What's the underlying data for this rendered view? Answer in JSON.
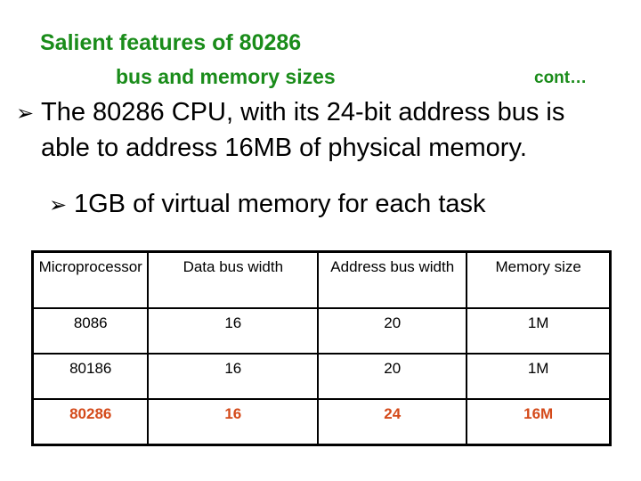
{
  "slide": {
    "title": "Salient features of 80286",
    "subtitle": "bus and memory sizes",
    "continuation": "cont…",
    "bullets": [
      {
        "icon": "arrowhead-bullet-icon",
        "glyph": "➢",
        "line1": "The 80286 CPU, with its 24-bit address bus is",
        "line2": "able to address 16MB of physical memory."
      },
      {
        "icon": "arrowhead-bullet-icon",
        "glyph": "➢",
        "text": "1GB of virtual memory for each task"
      }
    ],
    "colors": {
      "heading": "#1a8c1a",
      "highlight": "#d44a1a",
      "text": "#000000"
    }
  },
  "table": {
    "headers": [
      "Microprocessor",
      "Data bus width",
      "Address bus width",
      "Memory size"
    ],
    "rows": [
      [
        "8086",
        "16",
        "20",
        "1M"
      ],
      [
        "80186",
        "16",
        "20",
        "1M"
      ],
      [
        "80286",
        "16",
        "24",
        "16M"
      ]
    ],
    "highlighted_row": 2
  }
}
